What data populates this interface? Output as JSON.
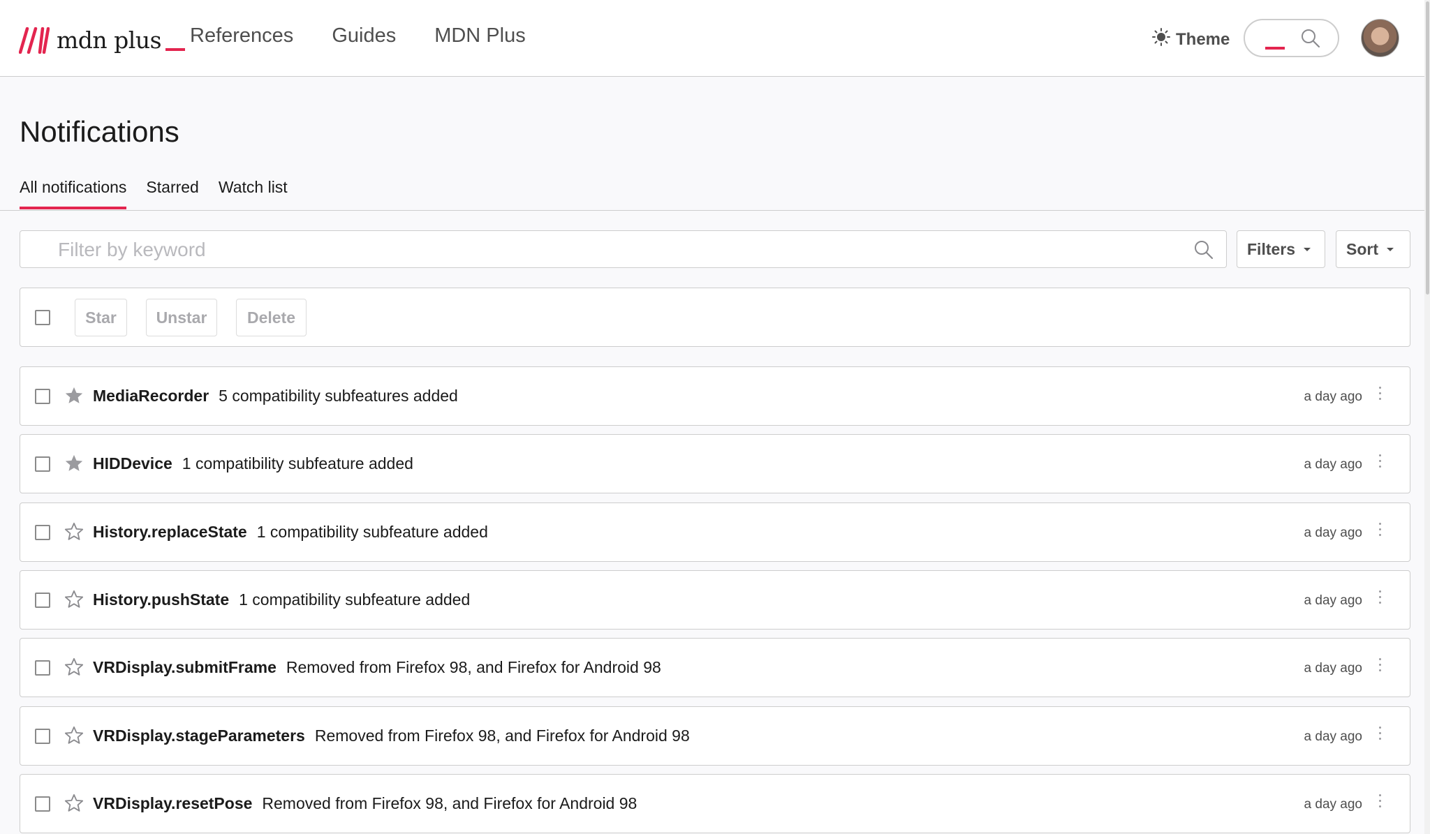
{
  "header": {
    "logo_text": "mdn plus",
    "nav": [
      "References",
      "Guides",
      "MDN Plus"
    ],
    "theme_label": "Theme",
    "icons": {
      "theme": "sun-icon",
      "search": "search-icon",
      "avatar": "user-avatar"
    }
  },
  "page": {
    "title": "Notifications",
    "tabs": [
      {
        "label": "All notifications",
        "active": true
      },
      {
        "label": "Starred",
        "active": false
      },
      {
        "label": "Watch list",
        "active": false
      }
    ]
  },
  "filter": {
    "placeholder": "Filter by keyword",
    "filters_label": "Filters",
    "sort_label": "Sort"
  },
  "bulk_actions": {
    "star_label": "Star",
    "unstar_label": "Unstar",
    "delete_label": "Delete"
  },
  "notifications": [
    {
      "name": "MediaRecorder",
      "desc": "5 compatibility subfeatures added",
      "time": "a day ago",
      "starred": true
    },
    {
      "name": "HIDDevice",
      "desc": "1 compatibility subfeature added",
      "time": "a day ago",
      "starred": true
    },
    {
      "name": "History.replaceState",
      "desc": "1 compatibility subfeature added",
      "time": "a day ago",
      "starred": false
    },
    {
      "name": "History.pushState",
      "desc": "1 compatibility subfeature added",
      "time": "a day ago",
      "starred": false
    },
    {
      "name": "VRDisplay.submitFrame",
      "desc": "Removed from Firefox 98, and Firefox for Android 98",
      "time": "a day ago",
      "starred": false
    },
    {
      "name": "VRDisplay.stageParameters",
      "desc": "Removed from Firefox 98, and Firefox for Android 98",
      "time": "a day ago",
      "starred": false
    },
    {
      "name": "VRDisplay.resetPose",
      "desc": "Removed from Firefox 98, and Firefox for Android 98",
      "time": "a day ago",
      "starred": false
    }
  ],
  "colors": {
    "accent": "#e3254f",
    "text": "#1b1b1b",
    "muted": "#4e4e4e",
    "border": "#cdcdcd",
    "page_bg": "#f9f9fb",
    "star_filled": "#9b9b9f"
  }
}
